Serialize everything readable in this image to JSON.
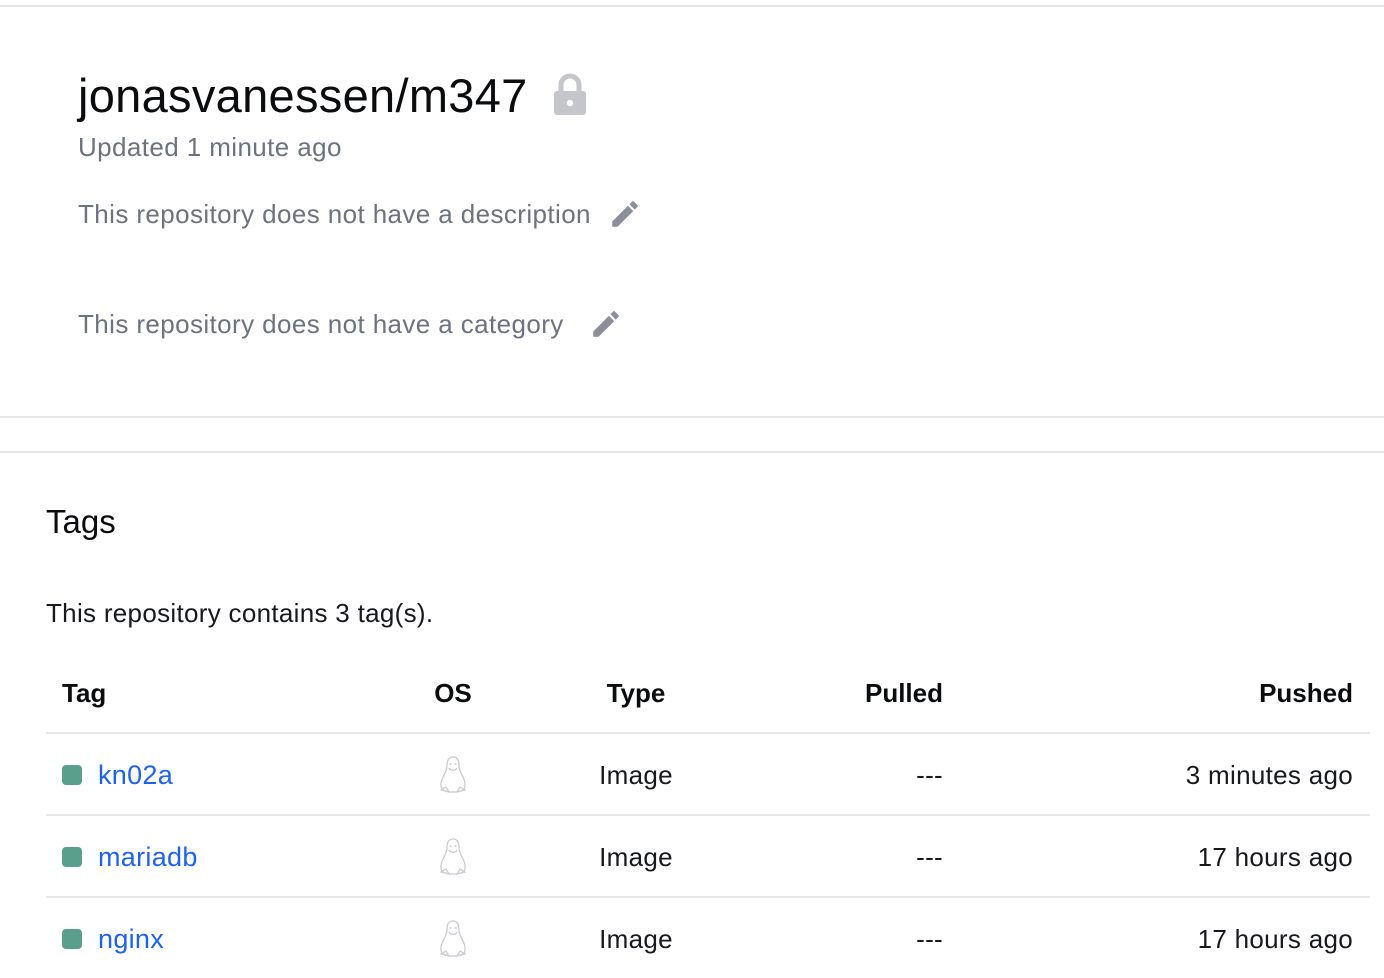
{
  "repo": {
    "name": "jonasvanessen/m347",
    "updated": "Updated 1 minute ago",
    "description_placeholder": "This repository does not have a description",
    "category_placeholder": "This repository does not have a category",
    "visibility_icon": "lock-icon",
    "edit_icon": "pencil-icon"
  },
  "tags": {
    "heading": "Tags",
    "count_text": "This repository contains 3 tag(s).",
    "columns": {
      "tag": "Tag",
      "os": "OS",
      "type": "Type",
      "pulled": "Pulled",
      "pushed": "Pushed"
    },
    "rows": [
      {
        "tag": "kn02a",
        "os_icon": "linux-icon",
        "type": "Image",
        "pulled": "---",
        "pushed": "3 minutes ago"
      },
      {
        "tag": "mariadb",
        "os_icon": "linux-icon",
        "type": "Image",
        "pulled": "---",
        "pushed": "17 hours ago"
      },
      {
        "tag": "nginx",
        "os_icon": "linux-icon",
        "type": "Image",
        "pulled": "---",
        "pushed": "17 hours ago"
      }
    ]
  },
  "colors": {
    "tag_status": "#5a9f8c",
    "link": "#1d63ed",
    "muted_text": "#6c7280",
    "icon_gray": "#8a8f99",
    "lock_gray": "#c4c6cb"
  }
}
